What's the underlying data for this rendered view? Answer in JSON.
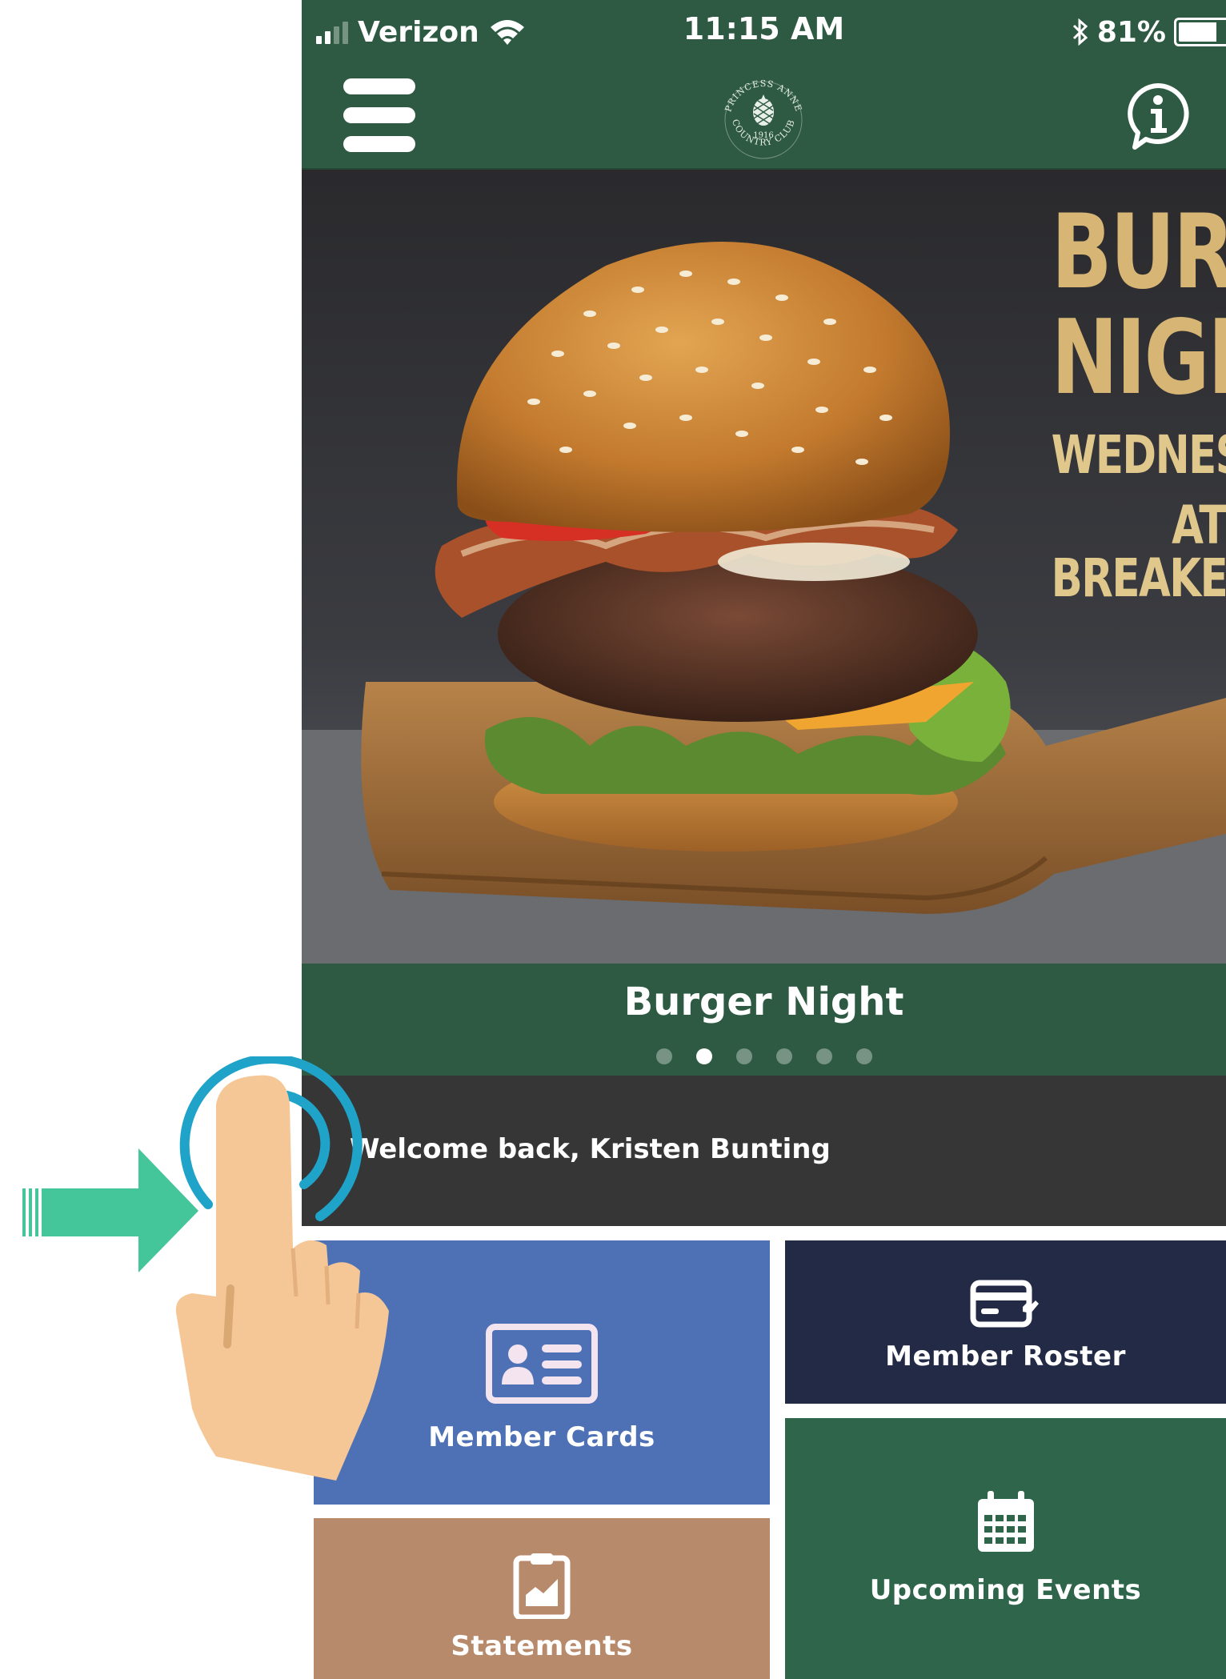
{
  "status_bar": {
    "carrier": "Verizon",
    "time": "11:15 AM",
    "battery_percent": "81%",
    "battery_level": 0.81,
    "bluetooth_icon": "bluetooth-icon",
    "wifi_icon": "wifi-icon"
  },
  "navbar": {
    "menu_icon": "hamburger-menu-icon",
    "logo": {
      "arc_top": "PRINCESS ANNE",
      "year": "1916",
      "arc_bottom": "COUNTRY CLUB"
    },
    "info_icon": "info-bubble-icon"
  },
  "banner": {
    "promo_line1": "BURGER",
    "promo_line2": "NIGHT",
    "promo_line3": "WEDNESDAYS",
    "promo_line4": "AT BREAKERS",
    "caption": "Burger Night",
    "slide_count": 6,
    "active_slide": 2
  },
  "welcome": {
    "text": "Welcome back, Kristen Bunting"
  },
  "tiles": {
    "member_cards": "Member Cards",
    "member_roster": "Member Roster",
    "upcoming_events": "Upcoming Events",
    "statements": "Statements"
  },
  "colors": {
    "header_green": "#2e5a43",
    "welcome_bar": "#363636",
    "member_cards_tile": "#4e71b6",
    "member_roster_tile": "#232a45",
    "upcoming_events_tile": "#2f654a",
    "statements_tile": "#b78a6b",
    "arrow": "#45c69a",
    "tap_ring": "#1fa3c9",
    "hand": "#f5c796",
    "promo_text": "#d6b575"
  },
  "overlay": {
    "arrow_icon": "pointer-arrow-icon",
    "hand_icon": "tapping-hand-icon",
    "ripple_icon": "tap-ripple-icon"
  }
}
